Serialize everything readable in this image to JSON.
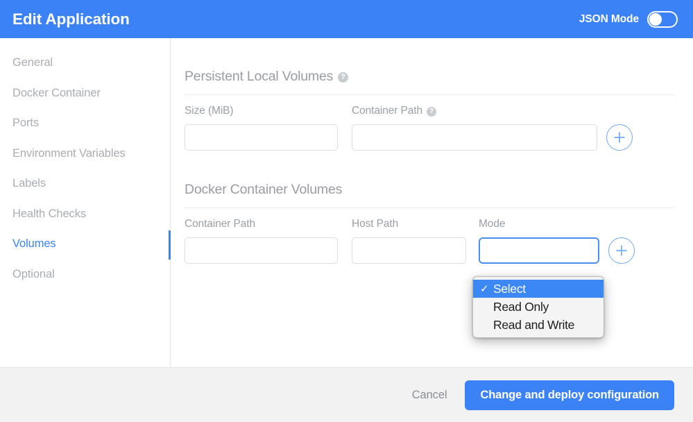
{
  "header": {
    "title": "Edit Application",
    "json_mode_label": "JSON Mode",
    "json_mode_on": false,
    "accent_color": "#3b82f6"
  },
  "sidebar": {
    "items": [
      {
        "label": "General",
        "active": false
      },
      {
        "label": "Docker Container",
        "active": false
      },
      {
        "label": "Ports",
        "active": false
      },
      {
        "label": "Environment Variables",
        "active": false
      },
      {
        "label": "Labels",
        "active": false
      },
      {
        "label": "Health Checks",
        "active": false
      },
      {
        "label": "Volumes",
        "active": true
      },
      {
        "label": "Optional",
        "active": false
      }
    ]
  },
  "main": {
    "sections": [
      {
        "title": "Persistent Local Volumes",
        "has_help_icon": true,
        "help_icon_name": "help-icon",
        "fields": [
          {
            "label": "Size (MiB)",
            "value": "",
            "placeholder": "",
            "has_help_icon": false
          },
          {
            "label": "Container Path",
            "value": "",
            "placeholder": "",
            "has_help_icon": true
          }
        ],
        "add_button_icon": "plus-circle-icon"
      },
      {
        "title": "Docker Container Volumes",
        "has_help_icon": false,
        "fields": [
          {
            "label": "Container Path",
            "value": "",
            "placeholder": "",
            "has_help_icon": false
          },
          {
            "label": "Host Path",
            "value": "",
            "placeholder": "",
            "has_help_icon": false
          },
          {
            "label": "Mode",
            "value": "Select",
            "placeholder": "",
            "has_help_icon": false
          }
        ],
        "add_button_icon": "plus-circle-icon"
      }
    ]
  },
  "dropdown": {
    "open": true,
    "for_field": "Mode",
    "check_glyph": "✓",
    "options": [
      {
        "label": "Select",
        "selected": true
      },
      {
        "label": "Read Only",
        "selected": false
      },
      {
        "label": "Read and Write",
        "selected": false
      }
    ]
  },
  "footer": {
    "cancel_label": "Cancel",
    "submit_label": "Change and deploy configuration"
  }
}
